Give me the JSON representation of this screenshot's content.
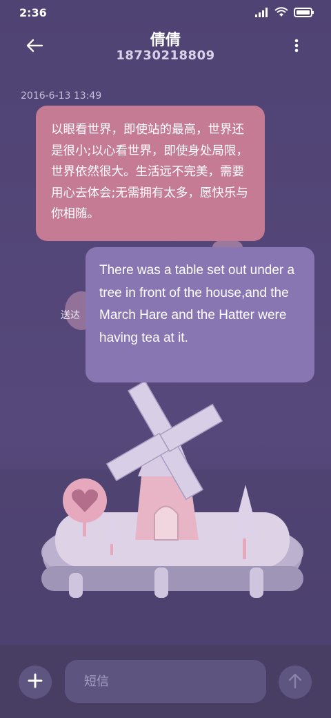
{
  "status_bar": {
    "time": "2:36"
  },
  "header": {
    "contact_name": "倩倩",
    "contact_number": "18730218809"
  },
  "conversation": {
    "timestamp": "2016-6-13 13:49",
    "messages": [
      {
        "direction": "incoming",
        "text": "以眼看世界，即使站的最高，世界还是很小;以心看世界，即使身处局限，世界依然很大。生活远不完美，需要用心去体会;无需拥有太多，愿快乐与你相随。"
      },
      {
        "direction": "outgoing",
        "text": "There was a table set out under a tree in front of the house,and the March Hare and the Hatter were having tea at it."
      }
    ],
    "delivered_label": "送达"
  },
  "composer": {
    "placeholder": "短信"
  },
  "colors": {
    "incoming_bubble": "#c67b94",
    "outgoing_bubble": "#8876b3",
    "background": "#4e4271"
  }
}
